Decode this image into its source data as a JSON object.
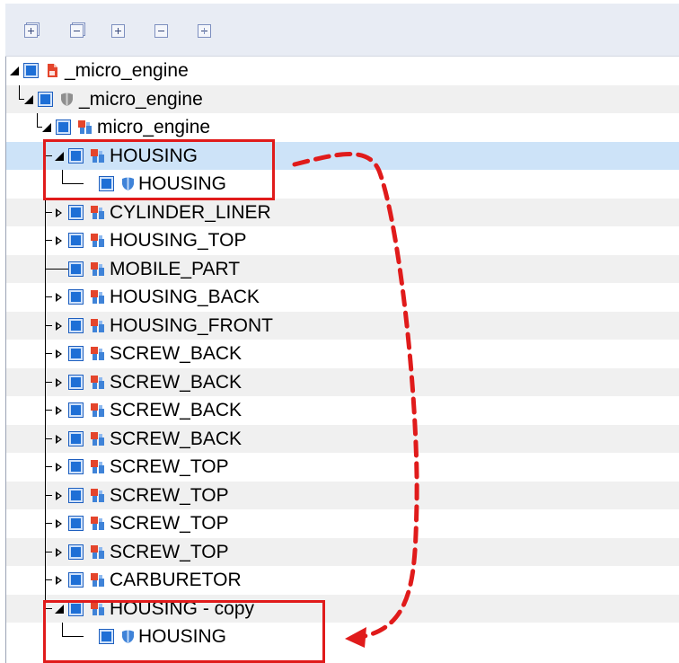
{
  "toolbar": {
    "buttons": [
      {
        "name": "expand-all-icon"
      },
      {
        "name": "collapse-all-icon"
      },
      {
        "name": "expand-icon"
      },
      {
        "name": "collapse-icon"
      },
      {
        "name": "expand-selected-icon"
      }
    ]
  },
  "tree": {
    "rows": [
      {
        "label": "_micro_engine",
        "icon": "document-icon",
        "level": 0,
        "expander": "down",
        "checked": true
      },
      {
        "label": "_micro_engine",
        "icon": "gray-shield-icon",
        "level": 1,
        "expander": "down",
        "checked": true
      },
      {
        "label": "micro_engine",
        "icon": "assembly-icon",
        "level": 2,
        "expander": "down",
        "checked": true
      },
      {
        "label": "HOUSING",
        "icon": "assembly-icon",
        "level": 3,
        "expander": "down",
        "checked": true,
        "selected": true
      },
      {
        "label": "HOUSING",
        "icon": "part-shield-icon",
        "level": 4,
        "expander": "none",
        "checked": true
      },
      {
        "label": "CYLINDER_LINER",
        "icon": "assembly-icon",
        "level": 3,
        "expander": "right",
        "checked": true
      },
      {
        "label": "HOUSING_TOP",
        "icon": "assembly-icon",
        "level": 3,
        "expander": "right",
        "checked": true
      },
      {
        "label": "MOBILE_PART",
        "icon": "assembly-icon",
        "level": 3,
        "expander": "none",
        "checked": true
      },
      {
        "label": "HOUSING_BACK",
        "icon": "assembly-icon",
        "level": 3,
        "expander": "right",
        "checked": true
      },
      {
        "label": "HOUSING_FRONT",
        "icon": "assembly-icon",
        "level": 3,
        "expander": "right",
        "checked": true
      },
      {
        "label": "SCREW_BACK",
        "icon": "assembly-icon",
        "level": 3,
        "expander": "right",
        "checked": true
      },
      {
        "label": "SCREW_BACK",
        "icon": "assembly-icon",
        "level": 3,
        "expander": "right",
        "checked": true
      },
      {
        "label": "SCREW_BACK",
        "icon": "assembly-icon",
        "level": 3,
        "expander": "right",
        "checked": true
      },
      {
        "label": "SCREW_BACK",
        "icon": "assembly-icon",
        "level": 3,
        "expander": "right",
        "checked": true
      },
      {
        "label": "SCREW_TOP",
        "icon": "assembly-icon",
        "level": 3,
        "expander": "right",
        "checked": true
      },
      {
        "label": "SCREW_TOP",
        "icon": "assembly-icon",
        "level": 3,
        "expander": "right",
        "checked": true
      },
      {
        "label": "SCREW_TOP",
        "icon": "assembly-icon",
        "level": 3,
        "expander": "right",
        "checked": true
      },
      {
        "label": "SCREW_TOP",
        "icon": "assembly-icon",
        "level": 3,
        "expander": "right",
        "checked": true
      },
      {
        "label": "CARBURETOR",
        "icon": "assembly-icon",
        "level": 3,
        "expander": "right",
        "checked": true
      },
      {
        "label": "HOUSING - copy",
        "icon": "assembly-icon",
        "level": 3,
        "expander": "down",
        "checked": true
      },
      {
        "label": "HOUSING",
        "icon": "part-shield-icon",
        "level": 4,
        "expander": "none",
        "checked": true
      }
    ]
  },
  "colors": {
    "annotation": "#e01b1b",
    "selection": "#cde3f8",
    "checkbox": "#1e6fd6"
  }
}
